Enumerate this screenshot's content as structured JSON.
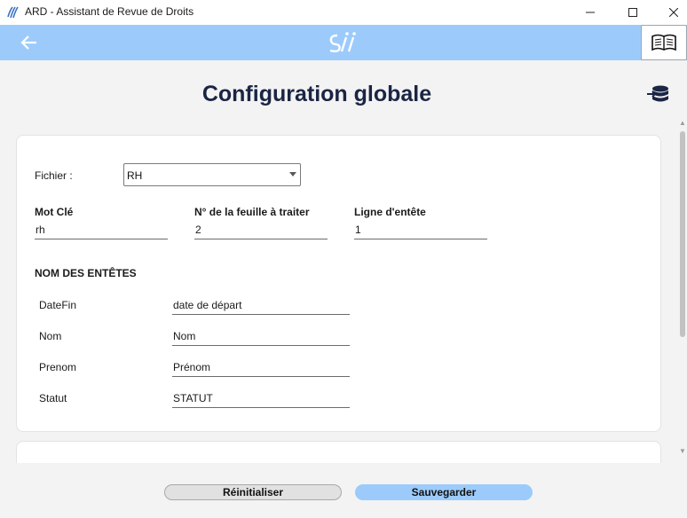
{
  "window": {
    "title": "ARD - Assistant de Revue de Droits"
  },
  "page": {
    "title": "Configuration globale"
  },
  "form": {
    "fichier_label": "Fichier :",
    "fichier_value": "RH",
    "mot_cle_label": "Mot Clé",
    "mot_cle_value": "rh",
    "feuille_label": "N° de la feuille à traiter",
    "feuille_value": "2",
    "ligne_label": "Ligne d'entête",
    "ligne_value": "1",
    "section_title": "NOM DES ENTÊTES",
    "headers": [
      {
        "label": "DateFin",
        "value": "date de départ"
      },
      {
        "label": "Nom",
        "value": "Nom"
      },
      {
        "label": "Prenom",
        "value": "Prénom"
      },
      {
        "label": "Statut",
        "value": "STATUT"
      }
    ]
  },
  "footer": {
    "reset_label": "Réinitialiser",
    "save_label": "Sauvegarder"
  },
  "icons": {
    "app": "app-logo-icon",
    "minimize": "minimize-icon",
    "maximize": "maximize-icon",
    "close": "close-icon",
    "back": "arrow-left-icon",
    "brand": "sii-logo",
    "book": "book-icon",
    "database": "database-import-icon"
  },
  "colors": {
    "accent": "#9ccbfb",
    "title": "#1b2544"
  }
}
